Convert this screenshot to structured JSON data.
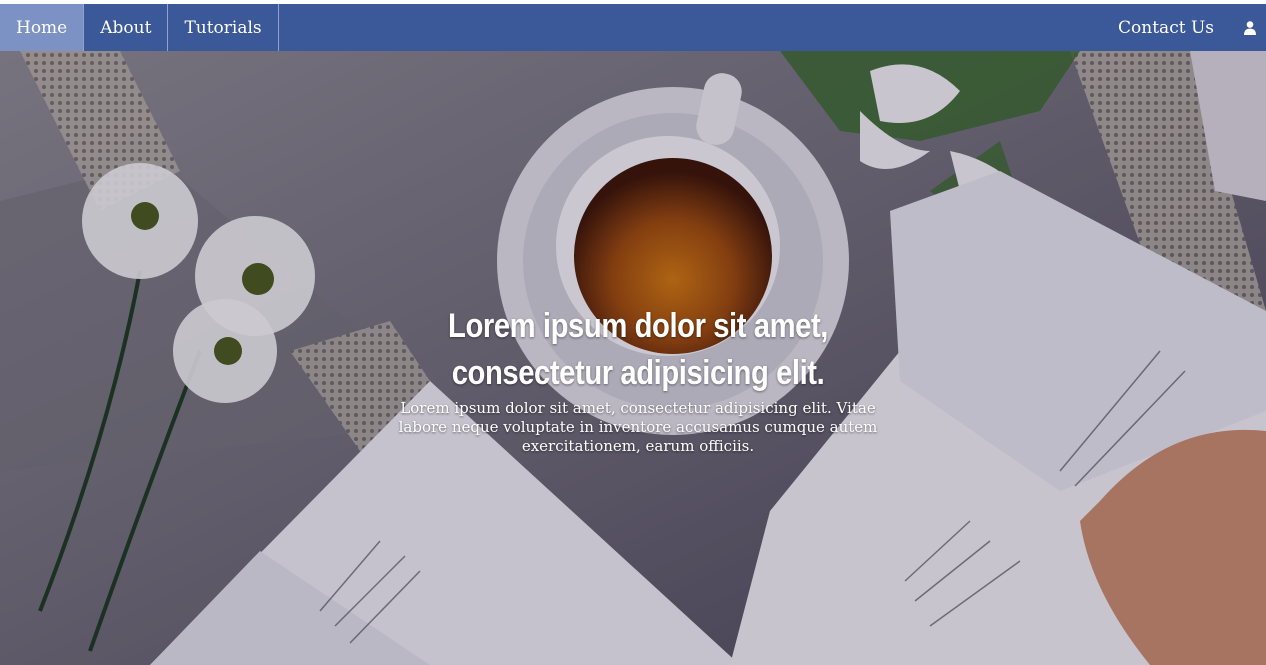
{
  "navbar": {
    "background": "#3b5998",
    "active_background": "#7c92c4",
    "items": [
      {
        "label": "Home",
        "active": true
      },
      {
        "label": "About",
        "active": false
      },
      {
        "label": "Tutorials",
        "active": false
      }
    ],
    "contact_label": "Contact Us",
    "user_icon": "user-icon"
  },
  "hero": {
    "title": "Lorem ipsum dolor sit amet, consectetur adipisicing elit.",
    "subtitle": "Lorem ipsum dolor sit amet, consectetur adipisicing elit. Vitae labore neque voluptate in inventore accusamus cumque autem exercitationem, earum officiis.",
    "image": "photo of cup of tea, white flowers and open books on a grey cloth"
  }
}
